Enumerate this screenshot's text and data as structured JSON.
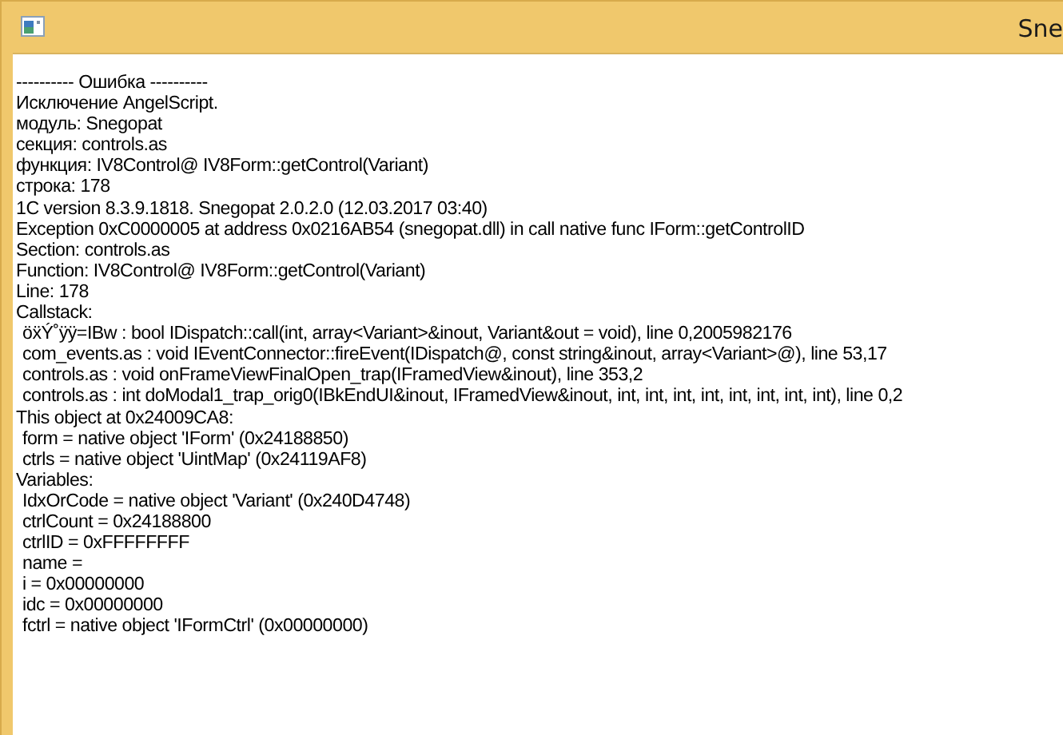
{
  "window": {
    "title": "Sne"
  },
  "lines": [
    {
      "text": "---------- Ошибка ----------",
      "indented": false
    },
    {
      "text": "Исключение AngelScript.",
      "indented": false
    },
    {
      "text": "модуль: Snegopat",
      "indented": false
    },
    {
      "text": "секция: controls.as",
      "indented": false
    },
    {
      "text": "функция: IV8Control@ IV8Form::getControl(Variant)",
      "indented": false
    },
    {
      "text": "строка: 178",
      "indented": false
    },
    {
      "text": "1C version 8.3.9.1818. Snegopat 2.0.2.0 (12.03.2017 03:40)",
      "indented": false
    },
    {
      "text": "Exception 0xC0000005 at address 0x0216AB54 (snegopat.dll) in call native func IForm::getControlID",
      "indented": false
    },
    {
      "text": "Section: controls.as",
      "indented": false
    },
    {
      "text": "Function: IV8Control@ IV8Form::getControl(Variant)",
      "indented": false
    },
    {
      "text": "Line: 178",
      "indented": false
    },
    {
      "text": "Callstack:",
      "indented": false
    },
    {
      "text": "öẍÝ˚ÿÿ=IBw : bool IDispatch::call(int, array<Variant>&inout, Variant&out = void), line 0,2005982176",
      "indented": true
    },
    {
      "text": "com_events.as : void IEventConnector::fireEvent(IDispatch@, const string&inout, array<Variant>@), line 53,17",
      "indented": true
    },
    {
      "text": "controls.as : void onFrameViewFinalOpen_trap(IFramedView&inout), line 353,2",
      "indented": true
    },
    {
      "text": "controls.as : int doModal1_trap_orig0(IBkEndUI&inout, IFramedView&inout, int, int, int, int, int, int, int, int), line 0,2",
      "indented": true
    },
    {
      "text": "This object at 0x24009CA8:",
      "indented": false
    },
    {
      "text": "form = native object 'IForm' (0x24188850)",
      "indented": true
    },
    {
      "text": "ctrls = native object 'UintMap' (0x24119AF8)",
      "indented": true
    },
    {
      "text": "Variables:",
      "indented": false
    },
    {
      "text": "IdxOrCode = native object 'Variant' (0x240D4748)",
      "indented": true
    },
    {
      "text": "ctrlCount = 0x24188800",
      "indented": true
    },
    {
      "text": "ctrlID = 0xFFFFFFFF",
      "indented": true
    },
    {
      "text": "name =",
      "indented": true
    },
    {
      "text": "i = 0x00000000",
      "indented": true
    },
    {
      "text": "idc = 0x00000000",
      "indented": true
    },
    {
      "text": "fctrl = native object 'IFormCtrl' (0x00000000)",
      "indented": true
    }
  ]
}
